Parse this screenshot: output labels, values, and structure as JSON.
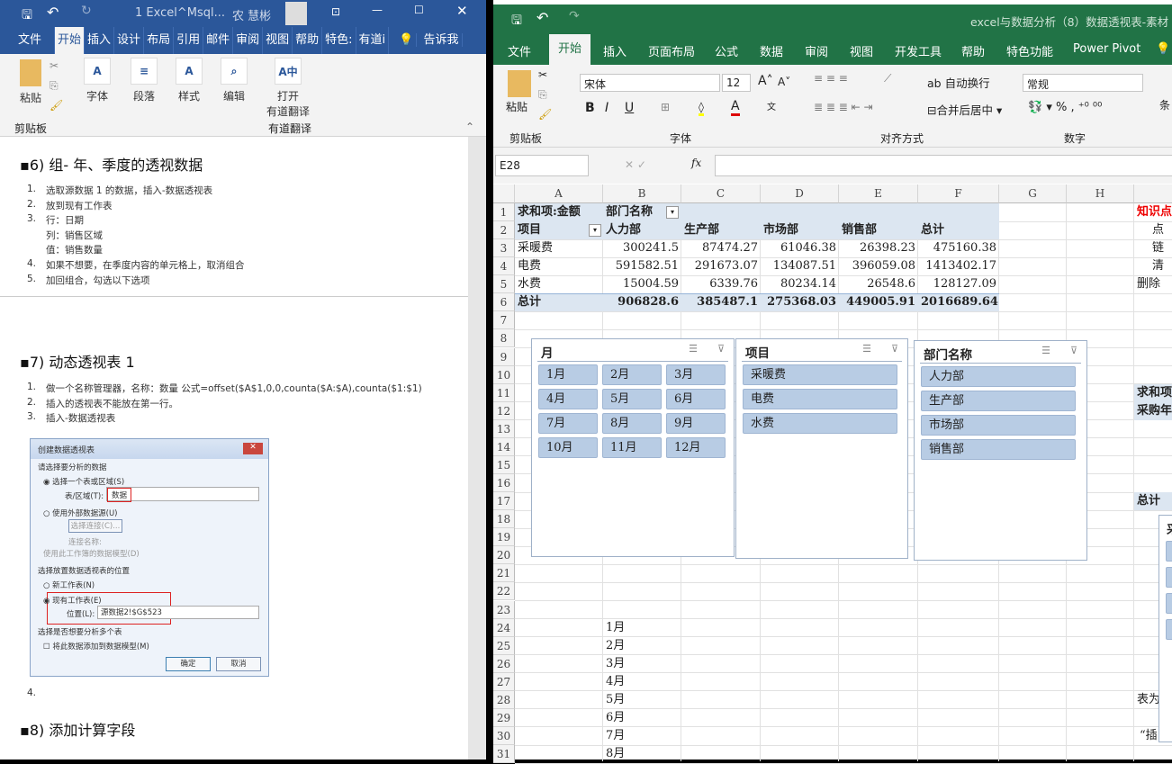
{
  "word": {
    "title": "1 Excel^Msql...",
    "user": "农 慧彬",
    "tabs": [
      "文件",
      "开始",
      "插入",
      "设计",
      "布局",
      "引用",
      "邮件",
      "审阅",
      "视图",
      "帮助",
      "特色:",
      "有道i",
      "告诉我"
    ],
    "ribbon": {
      "paste": "粘贴",
      "clipboard": "剪贴板",
      "font": "字体",
      "paragraph": "段落",
      "styles": "样式",
      "editing": "编辑",
      "youdao_open": "打开",
      "youdao_translate": "有道翻译",
      "youdao_group": "有道翻译"
    },
    "doc": {
      "h6": "▪6) 组- 年、季度的透视数据",
      "list6": [
        {
          "n": "1.",
          "t": "选取源数据 1 的数据，插入-数据透视表"
        },
        {
          "n": "2.",
          "t": "放到现有工作表"
        },
        {
          "n": "3.",
          "t": "行：日期"
        },
        {
          "n": "",
          "t": "列：销售区域"
        },
        {
          "n": "",
          "t": "值：销售数量"
        },
        {
          "n": "4.",
          "t": "如果不想要，在季度内容的单元格上，取消组合"
        },
        {
          "n": "5.",
          "t": "加回组合，勾选以下选项"
        }
      ],
      "h7": "▪7) 动态透视表 1",
      "list7": [
        {
          "n": "1.",
          "t": "做一个名称管理器，名称：数量  公式=offset($A$1,0,0,counta($A:$A),counta($1:$1)"
        },
        {
          "n": "2.",
          "t": "插入的透视表不能放在第一行。"
        },
        {
          "n": "3.",
          "t": "插入-数据透视表"
        }
      ],
      "item4": "4.",
      "h8": "▪8) 添加计算字段"
    },
    "dialog": {
      "title": "创建数据透视表",
      "sec1": "请选择要分析的数据",
      "opt_table": "选择一个表或区域(S)",
      "range_label": "表/区域(T):",
      "range_value": "数据",
      "opt_external": "使用外部数据源(U)",
      "choose_conn": "选择连接(C)...",
      "conn_name": "连接名称:",
      "opt_model": "使用此工作簿的数据模型(D)",
      "sec2": "选择放置数据透视表的位置",
      "opt_new": "新工作表(N)",
      "opt_existing": "现有工作表(E)",
      "loc_label": "位置(L):",
      "loc_value": "源数据2!$G$523",
      "sec3": "选择是否想要分析多个表",
      "add_model": "将此数据添加到数据模型(M)",
      "ok": "确定",
      "cancel": "取消"
    }
  },
  "excel": {
    "title": "excel与数据分析（8）数据透视表-素材 -",
    "tabs": [
      "文件",
      "开始",
      "插入",
      "页面布局",
      "公式",
      "数据",
      "审阅",
      "视图",
      "开发工具",
      "帮助",
      "特色功能",
      "Power Pivot"
    ],
    "ribbon": {
      "paste": "粘贴",
      "clipboard": "剪贴板",
      "font_name": "宋体",
      "font_size": "12",
      "font_group": "字体",
      "wrap": "自动换行",
      "merge": "合并后居中",
      "align_group": "对齐方式",
      "number_format": "常规",
      "number_group": "数字",
      "cond": "条"
    },
    "name_box": "E28",
    "fx": "fx",
    "columns": [
      "A",
      "B",
      "C",
      "D",
      "E",
      "F",
      "G",
      "H"
    ],
    "pivot": {
      "r1": [
        "求和项:金额",
        "部门名称"
      ],
      "headers": [
        "项目",
        "人力部",
        "生产部",
        "市场部",
        "销售部",
        "总计"
      ],
      "rows": [
        [
          "采暖费",
          "300241.5",
          "87474.27",
          "61046.38",
          "26398.23",
          "475160.38"
        ],
        [
          "电费",
          "591582.51",
          "291673.07",
          "134087.51",
          "396059.08",
          "1413402.17"
        ],
        [
          "水费",
          "15004.59",
          "6339.76",
          "80234.14",
          "26548.6",
          "128127.09"
        ]
      ],
      "total": [
        "总计",
        "906828.6",
        "385487.1",
        "275368.03",
        "449005.91",
        "2016689.64"
      ]
    },
    "col_i": {
      "r1": "知识点",
      "r2": "点",
      "r3": "链",
      "r4": "清",
      "r5": "删除",
      "r11": "求和项",
      "r12": "采购年",
      "r17": "总计",
      "r28": "表为",
      "r30": "“插"
    },
    "month_list": [
      "1月",
      "2月",
      "3月",
      "4月",
      "5月",
      "6月",
      "7月",
      "8月"
    ],
    "slicers": [
      {
        "title": "月",
        "items": [
          "1月",
          "2月",
          "3月",
          "4月",
          "5月",
          "6月",
          "7月",
          "8月",
          "9月",
          "10月",
          "11月",
          "12月"
        ]
      },
      {
        "title": "项目",
        "items": [
          "采暖费",
          "电费",
          "水费"
        ]
      },
      {
        "title": "部门名称",
        "items": [
          "人力部",
          "生产部",
          "市场部",
          "销售部"
        ]
      }
    ],
    "partial_slicer_title": "采"
  }
}
